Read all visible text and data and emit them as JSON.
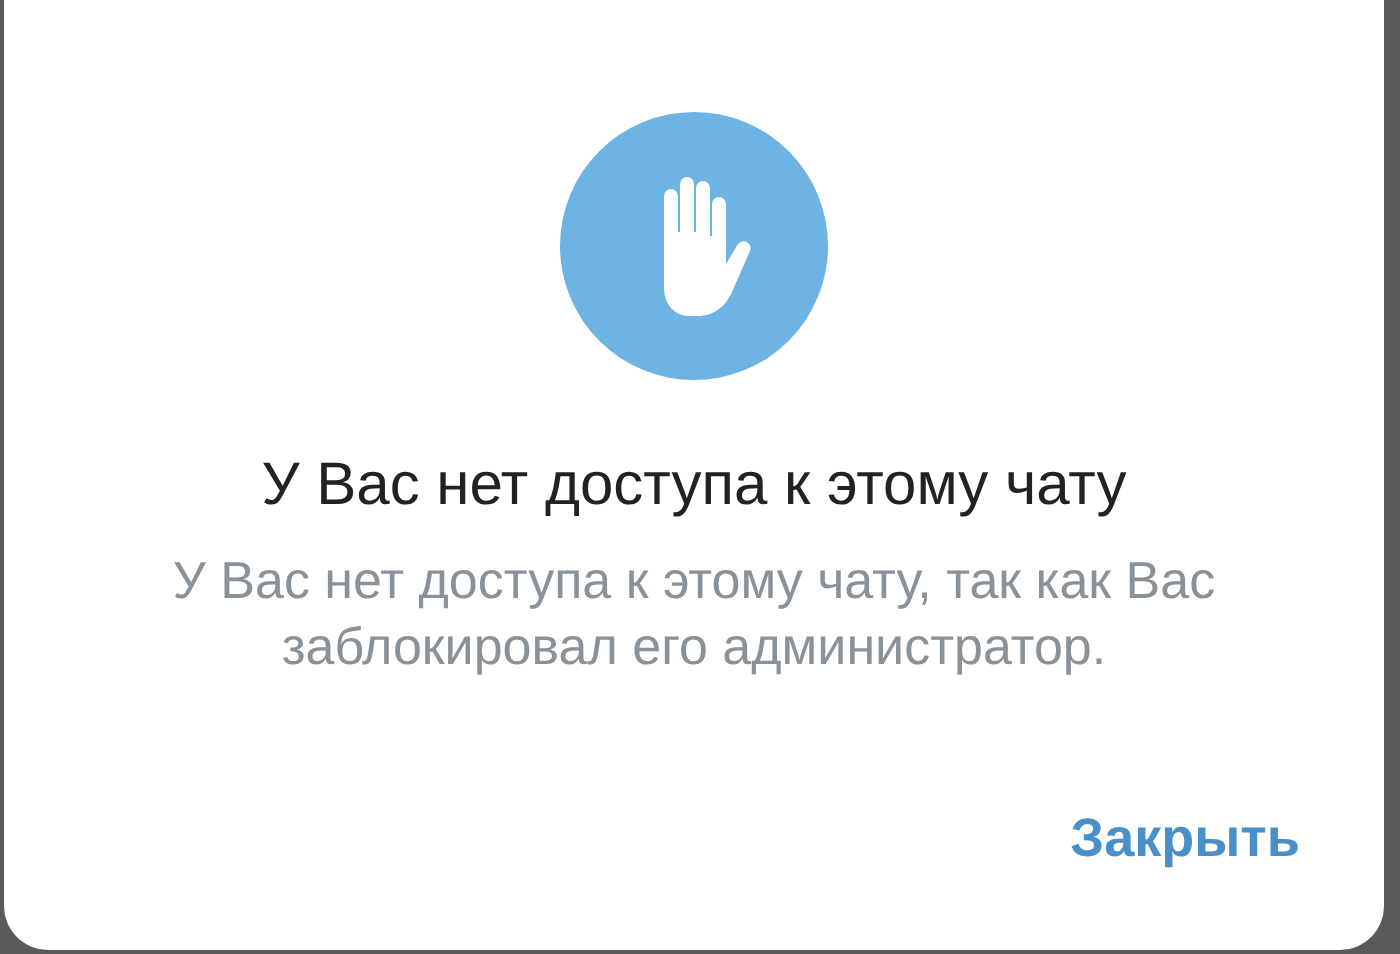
{
  "dialog": {
    "title": "У Вас нет доступа к этому чату",
    "message": "У Вас нет доступа к этому чату, так как Вас заблокировал его администратор.",
    "buttons": [
      "Закрыть"
    ]
  }
}
